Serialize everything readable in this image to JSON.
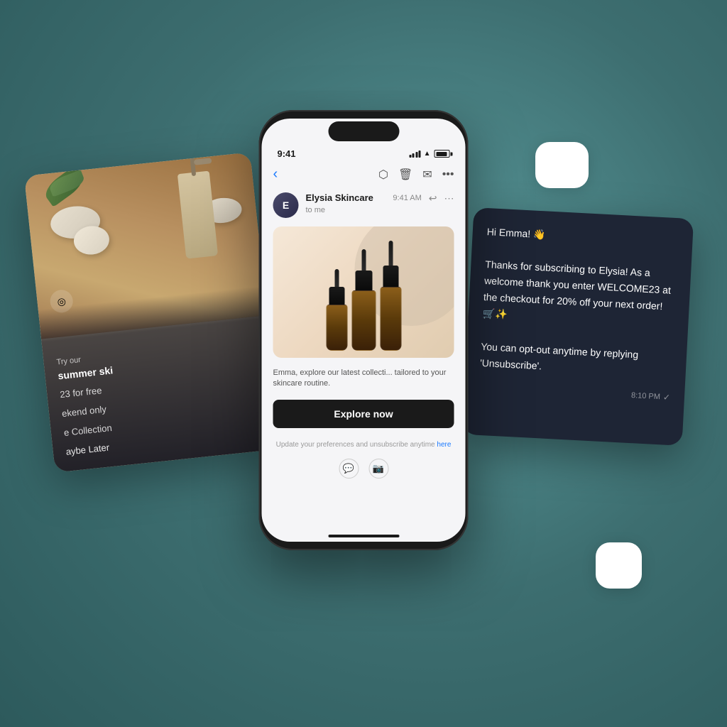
{
  "phone": {
    "status_time": "9:41",
    "email_nav_back": "‹",
    "sender_name": "Elysia Skincare",
    "sender_initials": "E",
    "sender_time": "9:41 AM",
    "recipient": "to me",
    "email_body": "Emma, explore our latest collecti... tailored to your skincare routine.",
    "explore_btn_label": "Explore now",
    "footer_text": "Update your preferences and unsubscribe anytime ",
    "footer_link": "here"
  },
  "left_card": {
    "small_text": "Try our",
    "title": "summer ski",
    "promo": "23 for free",
    "extra": "ekend only",
    "collection": "e Collection",
    "cta": "aybe Later"
  },
  "sms_card": {
    "greeting": "Hi Emma! 👋",
    "body": "Thanks for subscribing to Elysia! As a welcome thank you enter WELCOME23 at the checkout for 20% off your next order! 🛒✨\n\nYou can opt-out anytime by replying 'Unsubscribe'.",
    "time": "8:10 PM",
    "checkmark": "✓"
  },
  "colors": {
    "background": "#4a7a7c",
    "phone_bg": "#1a1a1a",
    "screen_bg": "#f5f5f7",
    "sms_card_bg": "#1e2535",
    "explore_btn_bg": "#1a1a1a",
    "accent_blue": "#1a7aff"
  }
}
